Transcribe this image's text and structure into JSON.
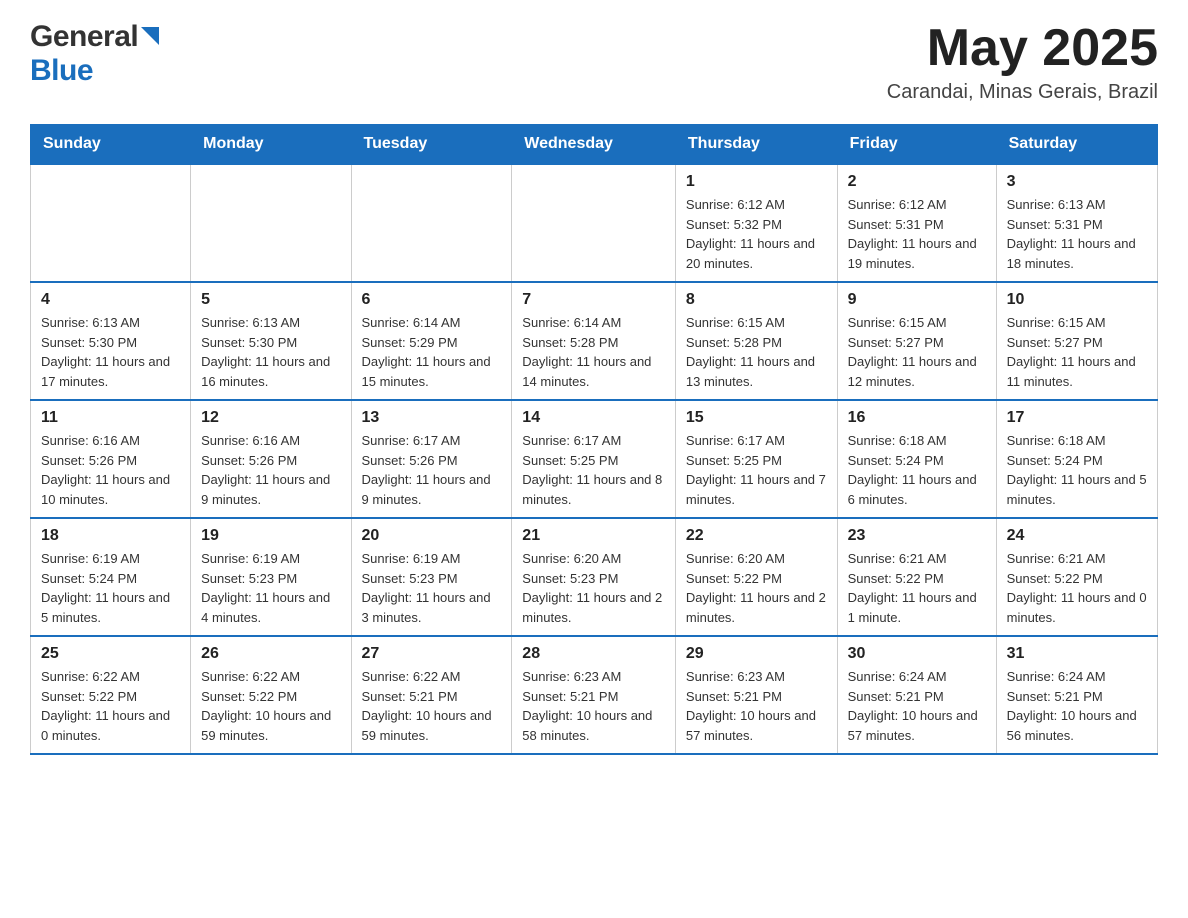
{
  "header": {
    "logo": {
      "general": "General",
      "blue": "Blue"
    },
    "title": "May 2025",
    "location": "Carandai, Minas Gerais, Brazil"
  },
  "days_of_week": [
    "Sunday",
    "Monday",
    "Tuesday",
    "Wednesday",
    "Thursday",
    "Friday",
    "Saturday"
  ],
  "weeks": [
    {
      "days": [
        {
          "num": "",
          "info": ""
        },
        {
          "num": "",
          "info": ""
        },
        {
          "num": "",
          "info": ""
        },
        {
          "num": "",
          "info": ""
        },
        {
          "num": "1",
          "info": "Sunrise: 6:12 AM\nSunset: 5:32 PM\nDaylight: 11 hours and 20 minutes."
        },
        {
          "num": "2",
          "info": "Sunrise: 6:12 AM\nSunset: 5:31 PM\nDaylight: 11 hours and 19 minutes."
        },
        {
          "num": "3",
          "info": "Sunrise: 6:13 AM\nSunset: 5:31 PM\nDaylight: 11 hours and 18 minutes."
        }
      ]
    },
    {
      "days": [
        {
          "num": "4",
          "info": "Sunrise: 6:13 AM\nSunset: 5:30 PM\nDaylight: 11 hours and 17 minutes."
        },
        {
          "num": "5",
          "info": "Sunrise: 6:13 AM\nSunset: 5:30 PM\nDaylight: 11 hours and 16 minutes."
        },
        {
          "num": "6",
          "info": "Sunrise: 6:14 AM\nSunset: 5:29 PM\nDaylight: 11 hours and 15 minutes."
        },
        {
          "num": "7",
          "info": "Sunrise: 6:14 AM\nSunset: 5:28 PM\nDaylight: 11 hours and 14 minutes."
        },
        {
          "num": "8",
          "info": "Sunrise: 6:15 AM\nSunset: 5:28 PM\nDaylight: 11 hours and 13 minutes."
        },
        {
          "num": "9",
          "info": "Sunrise: 6:15 AM\nSunset: 5:27 PM\nDaylight: 11 hours and 12 minutes."
        },
        {
          "num": "10",
          "info": "Sunrise: 6:15 AM\nSunset: 5:27 PM\nDaylight: 11 hours and 11 minutes."
        }
      ]
    },
    {
      "days": [
        {
          "num": "11",
          "info": "Sunrise: 6:16 AM\nSunset: 5:26 PM\nDaylight: 11 hours and 10 minutes."
        },
        {
          "num": "12",
          "info": "Sunrise: 6:16 AM\nSunset: 5:26 PM\nDaylight: 11 hours and 9 minutes."
        },
        {
          "num": "13",
          "info": "Sunrise: 6:17 AM\nSunset: 5:26 PM\nDaylight: 11 hours and 9 minutes."
        },
        {
          "num": "14",
          "info": "Sunrise: 6:17 AM\nSunset: 5:25 PM\nDaylight: 11 hours and 8 minutes."
        },
        {
          "num": "15",
          "info": "Sunrise: 6:17 AM\nSunset: 5:25 PM\nDaylight: 11 hours and 7 minutes."
        },
        {
          "num": "16",
          "info": "Sunrise: 6:18 AM\nSunset: 5:24 PM\nDaylight: 11 hours and 6 minutes."
        },
        {
          "num": "17",
          "info": "Sunrise: 6:18 AM\nSunset: 5:24 PM\nDaylight: 11 hours and 5 minutes."
        }
      ]
    },
    {
      "days": [
        {
          "num": "18",
          "info": "Sunrise: 6:19 AM\nSunset: 5:24 PM\nDaylight: 11 hours and 5 minutes."
        },
        {
          "num": "19",
          "info": "Sunrise: 6:19 AM\nSunset: 5:23 PM\nDaylight: 11 hours and 4 minutes."
        },
        {
          "num": "20",
          "info": "Sunrise: 6:19 AM\nSunset: 5:23 PM\nDaylight: 11 hours and 3 minutes."
        },
        {
          "num": "21",
          "info": "Sunrise: 6:20 AM\nSunset: 5:23 PM\nDaylight: 11 hours and 2 minutes."
        },
        {
          "num": "22",
          "info": "Sunrise: 6:20 AM\nSunset: 5:22 PM\nDaylight: 11 hours and 2 minutes."
        },
        {
          "num": "23",
          "info": "Sunrise: 6:21 AM\nSunset: 5:22 PM\nDaylight: 11 hours and 1 minute."
        },
        {
          "num": "24",
          "info": "Sunrise: 6:21 AM\nSunset: 5:22 PM\nDaylight: 11 hours and 0 minutes."
        }
      ]
    },
    {
      "days": [
        {
          "num": "25",
          "info": "Sunrise: 6:22 AM\nSunset: 5:22 PM\nDaylight: 11 hours and 0 minutes."
        },
        {
          "num": "26",
          "info": "Sunrise: 6:22 AM\nSunset: 5:22 PM\nDaylight: 10 hours and 59 minutes."
        },
        {
          "num": "27",
          "info": "Sunrise: 6:22 AM\nSunset: 5:21 PM\nDaylight: 10 hours and 59 minutes."
        },
        {
          "num": "28",
          "info": "Sunrise: 6:23 AM\nSunset: 5:21 PM\nDaylight: 10 hours and 58 minutes."
        },
        {
          "num": "29",
          "info": "Sunrise: 6:23 AM\nSunset: 5:21 PM\nDaylight: 10 hours and 57 minutes."
        },
        {
          "num": "30",
          "info": "Sunrise: 6:24 AM\nSunset: 5:21 PM\nDaylight: 10 hours and 57 minutes."
        },
        {
          "num": "31",
          "info": "Sunrise: 6:24 AM\nSunset: 5:21 PM\nDaylight: 10 hours and 56 minutes."
        }
      ]
    }
  ]
}
